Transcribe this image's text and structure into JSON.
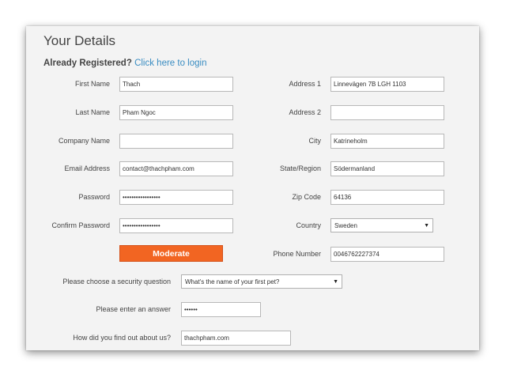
{
  "header": {
    "title": "Your Details",
    "already_registered": "Already Registered?",
    "login_link": "Click here to login"
  },
  "left": {
    "first_name": {
      "label": "First Name",
      "value": "Thach"
    },
    "last_name": {
      "label": "Last Name",
      "value": "Pham Ngoc"
    },
    "company_name": {
      "label": "Company Name",
      "value": ""
    },
    "email": {
      "label": "Email Address",
      "value": "contact@thachpham.com"
    },
    "password": {
      "label": "Password",
      "value": "•••••••••••••••••"
    },
    "confirm_password": {
      "label": "Confirm Password",
      "value": "•••••••••••••••••"
    },
    "strength": "Moderate"
  },
  "right": {
    "address1": {
      "label": "Address 1",
      "value": "Linnevägen 7B LGH 1103"
    },
    "address2": {
      "label": "Address 2",
      "value": ""
    },
    "city": {
      "label": "City",
      "value": "Katrineholm"
    },
    "state": {
      "label": "State/Region",
      "value": "Södermanland"
    },
    "zip": {
      "label": "Zip Code",
      "value": "64136"
    },
    "country": {
      "label": "Country",
      "value": "Sweden"
    },
    "phone": {
      "label": "Phone Number",
      "value": "0046762227374"
    }
  },
  "bottom": {
    "security_question": {
      "label": "Please choose a security question",
      "value": "What's the name of your first pet?"
    },
    "answer": {
      "label": "Please enter an answer",
      "value": "••••••"
    },
    "referral": {
      "label": "How did you find out about us?",
      "value": "thachpham.com"
    }
  },
  "colors": {
    "accent": "#f26522",
    "link": "#3a8dc2",
    "panel": "#f3f3f3"
  },
  "icons": {
    "dropdown": "chevron-down-icon"
  }
}
